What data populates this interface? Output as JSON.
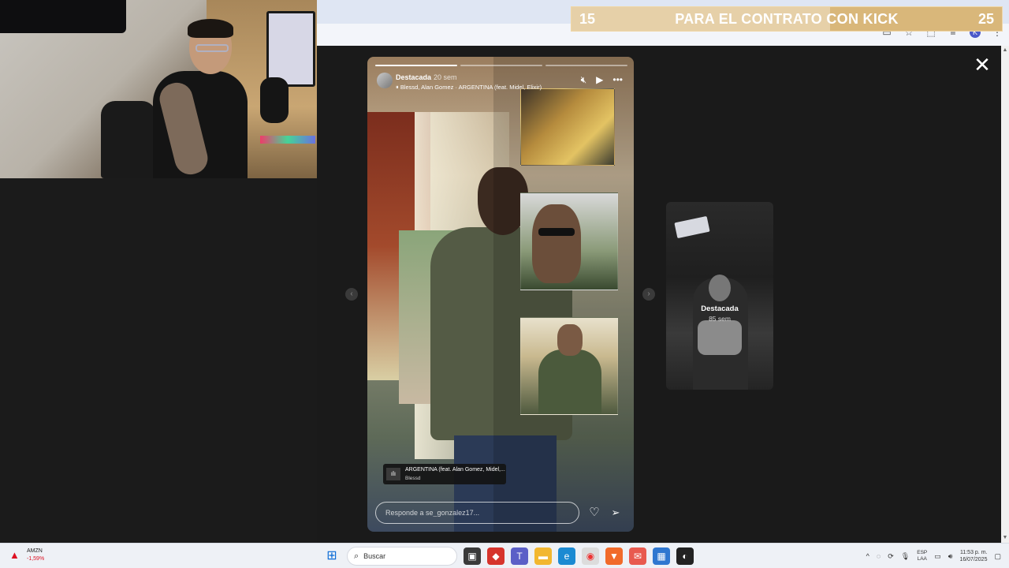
{
  "kick_banner": {
    "left_number": "15",
    "text": "PARA EL CONTRATO CON KICK",
    "right_number": "25",
    "progress_fraction": 0.6,
    "color": "#d9b77a"
  },
  "story": {
    "username": "Destacada",
    "time_ago": "20 sem",
    "music_line": "Blessd, Alan Gomez · ARGENTINA (feat. Midel, Elixir)",
    "sticker_title": "ARGENTINA (feat. Alan Gomez, Midel,...",
    "sticker_artist": "Blessd",
    "reply_placeholder": "Responde a se_gonzalez17...",
    "icons": {
      "mute": "mute-icon",
      "play": "play-icon",
      "more": "more-icon",
      "heart": "heart-icon",
      "send": "send-icon",
      "close": "close-icon"
    },
    "segments": 3,
    "active_segment": 1
  },
  "next_story": {
    "label": "Destacada",
    "time_ago": "85 sem"
  },
  "taskbar": {
    "ticker_symbol": "AMZN",
    "ticker_change": "-1,59%",
    "search_label": "Buscar",
    "language": "ESP",
    "keyboard": "LAA",
    "time": "11:53 p. m.",
    "date": "16/07/2025"
  }
}
